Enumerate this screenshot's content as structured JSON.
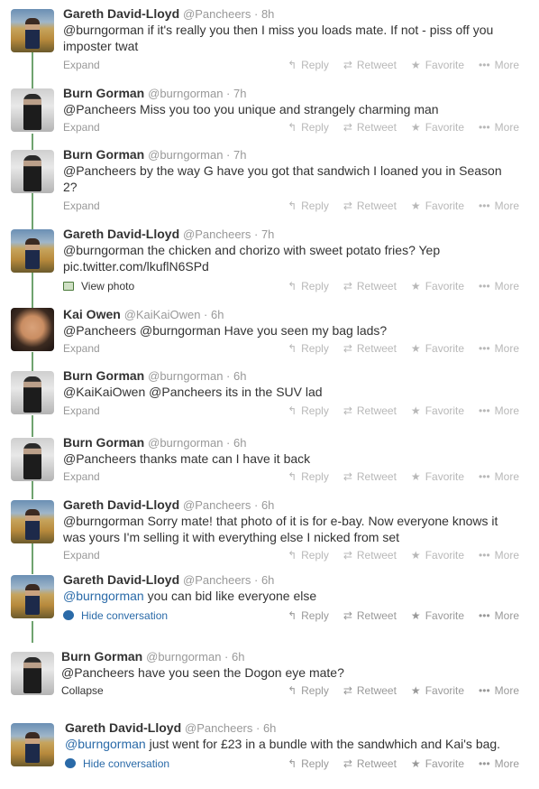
{
  "tweets": [
    {
      "avatar": "gareth",
      "avatar_icon": "gareth-avatar",
      "name": "Gareth David-Lloyd",
      "handle": "@Pancheers",
      "time": "8h",
      "text": "@burngorman if it's really you then I miss you loads mate. If not - piss off you imposter twat",
      "meta": "Expand",
      "meta_kind": "plain",
      "actions": {
        "reply": "Reply",
        "retweet": "Retweet",
        "favorite": "Favorite",
        "more": "More"
      }
    },
    {
      "avatar": "burn",
      "avatar_icon": "burn-avatar",
      "name": "Burn Gorman",
      "handle": "@burngorman",
      "time": "7h",
      "text": "@Pancheers Miss you too you unique and strangely charming man",
      "meta": "Expand",
      "meta_kind": "plain",
      "actions": {
        "reply": "Reply",
        "retweet": "Retweet",
        "favorite": "Favorite",
        "more": "More"
      }
    },
    {
      "avatar": "burn",
      "avatar_icon": "burn-avatar",
      "name": "Burn Gorman",
      "handle": "@burngorman",
      "time": "7h",
      "text": "@Pancheers by the way G have you got that sandwich I loaned you in Season 2?",
      "meta": "Expand",
      "meta_kind": "plain",
      "actions": {
        "reply": "Reply",
        "retweet": "Retweet",
        "favorite": "Favorite",
        "more": "More"
      }
    },
    {
      "avatar": "gareth",
      "avatar_icon": "gareth-avatar",
      "name": "Gareth David-Lloyd",
      "handle": "@Pancheers",
      "time": "7h",
      "text": "@burngorman the chicken and chorizo with sweet potato fries? Yep pic.twitter.com/lkuflN6SPd",
      "meta": "View photo",
      "meta_kind": "photo",
      "actions": {
        "reply": "Reply",
        "retweet": "Retweet",
        "favorite": "Favorite",
        "more": "More"
      }
    },
    {
      "avatar": "kai",
      "avatar_icon": "kai-avatar",
      "name": "Kai Owen",
      "handle": "@KaiKaiOwen",
      "time": "6h",
      "text": "@Pancheers @burngorman Have you seen my bag lads?",
      "meta": "Expand",
      "meta_kind": "plain",
      "actions": {
        "reply": "Reply",
        "retweet": "Retweet",
        "favorite": "Favorite",
        "more": "More"
      }
    },
    {
      "avatar": "burn",
      "avatar_icon": "burn-avatar",
      "name": "Burn Gorman",
      "handle": "@burngorman",
      "time": "6h",
      "text": "@KaiKaiOwen @Pancheers its in the SUV lad",
      "meta": "Expand",
      "meta_kind": "plain",
      "actions": {
        "reply": "Reply",
        "retweet": "Retweet",
        "favorite": "Favorite",
        "more": "More"
      }
    },
    {
      "avatar": "burn",
      "avatar_icon": "burn-avatar",
      "name": "Burn Gorman",
      "handle": "@burngorman",
      "time": "6h",
      "text": "@Pancheers thanks mate can I have it back",
      "meta": "Expand",
      "meta_kind": "plain",
      "actions": {
        "reply": "Reply",
        "retweet": "Retweet",
        "favorite": "Favorite",
        "more": "More"
      }
    },
    {
      "avatar": "gareth",
      "avatar_icon": "gareth-avatar",
      "name": "Gareth David-Lloyd",
      "handle": "@Pancheers",
      "time": "6h",
      "text": "@burngorman Sorry mate! that photo of it is for e-bay. Now everyone knows it was yours I'm selling it with everything else I nicked from set",
      "meta": "Expand",
      "meta_kind": "plain",
      "actions": {
        "reply": "Reply",
        "retweet": "Retweet",
        "favorite": "Favorite",
        "more": "More"
      }
    },
    {
      "avatar": "gareth",
      "avatar_icon": "gareth-avatar",
      "name": "Gareth David-Lloyd",
      "handle": "@Pancheers",
      "time": "6h",
      "mention": "@burngorman",
      "text": " you can bid like everyone else",
      "meta": "Hide conversation",
      "meta_kind": "conversation",
      "actions": {
        "reply": "Reply",
        "retweet": "Retweet",
        "favorite": "Favorite",
        "more": "More"
      }
    },
    {
      "avatar": "burn",
      "avatar_icon": "burn-avatar",
      "name": "Burn Gorman",
      "handle": "@burngorman",
      "time": "6h",
      "text": "@Pancheers have you seen the Dogon eye mate?",
      "meta": "Collapse",
      "meta_kind": "dark",
      "actions": {
        "reply": "Reply",
        "retweet": "Retweet",
        "favorite": "Favorite",
        "more": "More"
      }
    },
    {
      "avatar": "gareth",
      "avatar_icon": "gareth-avatar",
      "name": "Gareth David-Lloyd",
      "handle": "@Pancheers",
      "time": "6h",
      "mention": "@burngorman",
      "text": " just went for £23 in a bundle with the sandwhich and Kai's bag.",
      "meta": "Hide conversation",
      "meta_kind": "conversation",
      "actions": {
        "reply": "Reply",
        "retweet": "Retweet",
        "favorite": "Favorite",
        "more": "More"
      }
    }
  ]
}
